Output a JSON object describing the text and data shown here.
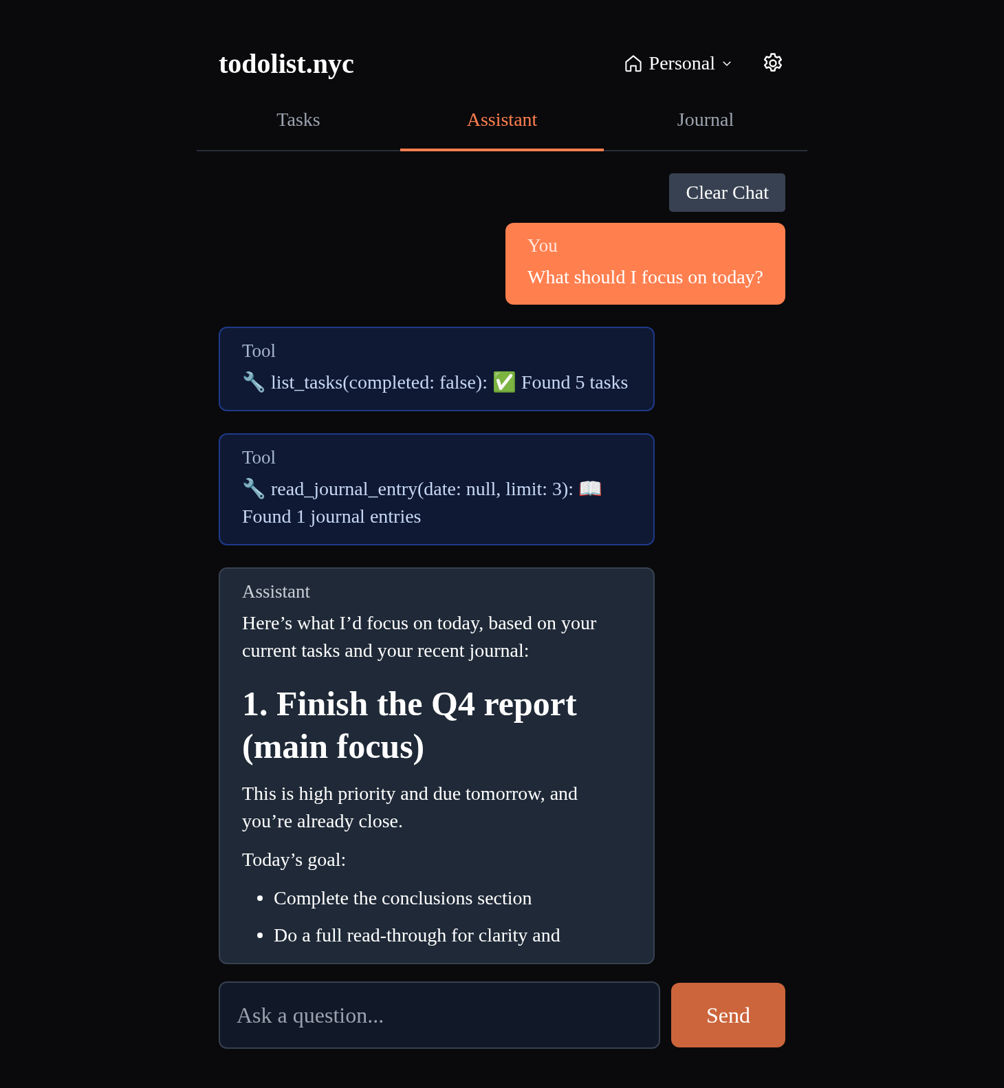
{
  "header": {
    "logo": "todolist.nyc",
    "workspace": "Personal"
  },
  "tabs": [
    {
      "label": "Tasks",
      "selected": false
    },
    {
      "label": "Assistant",
      "selected": true
    },
    {
      "label": "Journal",
      "selected": false
    }
  ],
  "clear_button": "Clear Chat",
  "messages": [
    {
      "kind": "user",
      "sender": "You",
      "text": "What should I focus on today?"
    },
    {
      "kind": "tool",
      "sender": "Tool",
      "text": "🔧 list_tasks(completed: false): ✅ Found 5 tasks"
    },
    {
      "kind": "tool",
      "sender": "Tool",
      "text": "🔧 read_journal_entry(date: null, limit: 3): 📖 Found 1 journal entries"
    },
    {
      "kind": "assistant",
      "sender": "Assistant",
      "blocks": [
        {
          "kind": "paragraph",
          "text": "Here’s what I’d focus on today, based on your current tasks and your recent journal:"
        },
        {
          "kind": "heading",
          "text": "1. Finish the Q4 report (main focus)"
        },
        {
          "kind": "paragraph",
          "text": "This is high priority and due tomorrow, and you’re already close."
        },
        {
          "kind": "paragraph",
          "text": "Today’s goal:"
        },
        {
          "kind": "list",
          "items": [
            "Complete the conclusions section",
            "Do a full read-through for clarity and"
          ]
        }
      ]
    }
  ],
  "composer": {
    "placeholder": "Ask a question...",
    "send": "Send"
  }
}
